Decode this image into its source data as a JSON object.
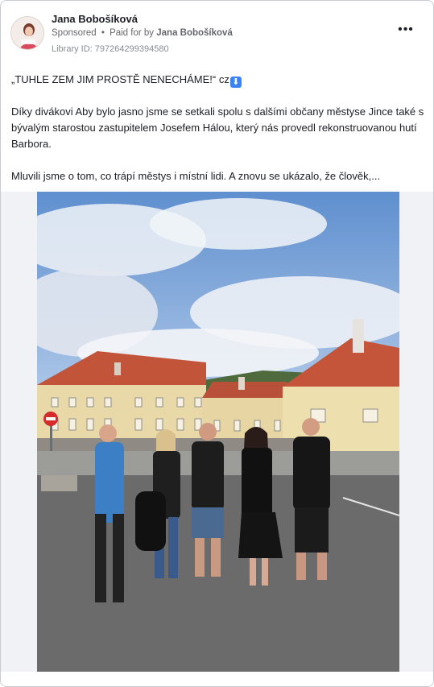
{
  "post": {
    "page_name": "Jana Bobošíková",
    "sponsored_label": "Sponsored",
    "separator": "•",
    "paid_prefix": "Paid for by",
    "paid_by": "Jana Bobošíková",
    "library_id": "Library ID: 797264299394580",
    "more_glyph": "•••"
  },
  "content": {
    "line1_text": "„TUHLE ZEM JIM PROSTĚ NENECHÁME!“ cz",
    "line1_emoji": "⬇",
    "paragraph2": "Díky divákovi Aby bylo jasno jsme se setkali spolu s dalšími občany městyse Jince také s bývalým starostou zastupitelem Josefem Hálou, který nás provedl rekonstruovanou hutí Barbora.",
    "paragraph3": "Mluvili jsme o tom, co trápí městys i místní lidi. A znovu se ukázalo, že člověk,..."
  },
  "colors": {
    "text": "#1c1e21",
    "secondary": "#65676b",
    "sky": "#6f9fd8",
    "roof": "#c2543a",
    "facade": "#ead9a8",
    "asphalt": "#6b6b6b"
  },
  "icons": {
    "avatar": "avatar-image",
    "more": "more-horizontal-icon",
    "emoji": "down-arrow-emoji",
    "no_entry_sign": "no-entry-sign"
  }
}
